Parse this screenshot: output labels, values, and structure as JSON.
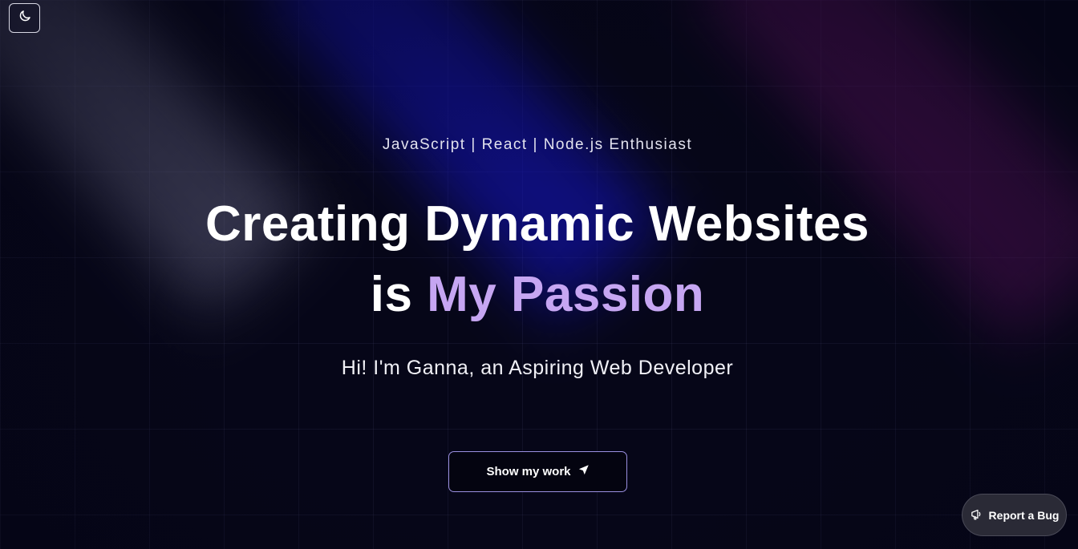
{
  "theme_toggle": {
    "icon": "moon-icon"
  },
  "hero": {
    "tagline": "JavaScript | React | Node.js Enthusiast",
    "headline_line1": "Creating Dynamic Websites",
    "headline_line2_prefix": "is ",
    "headline_line2_accent": "My Passion",
    "subtitle": "Hi! I'm Ganna, an Aspiring Web Developer"
  },
  "cta": {
    "label": "Show my work",
    "icon": "send-arrow-icon"
  },
  "report_bug": {
    "label": "Report a Bug",
    "icon": "megaphone-icon"
  },
  "colors": {
    "background": "#060618",
    "accent": "#c6a6f2",
    "cta_border": "#9a8fe0",
    "report_bg": "#2a2a36"
  }
}
